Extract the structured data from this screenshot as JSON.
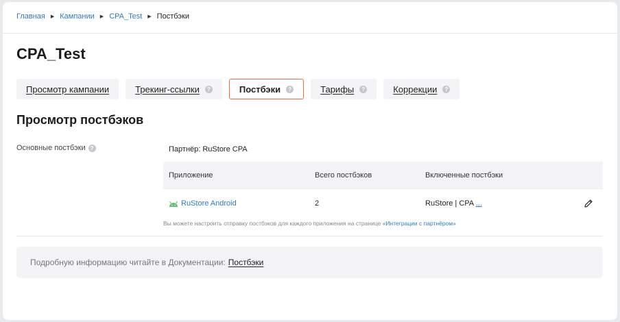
{
  "breadcrumb": {
    "items": [
      "Главная",
      "Кампании",
      "CPA_Test"
    ],
    "current": "Постбэки"
  },
  "page": {
    "title": "CPA_Test",
    "section_title": "Просмотр постбэков"
  },
  "tabs": [
    {
      "label": "Просмотр кампании",
      "has_help": false,
      "active": false
    },
    {
      "label": "Трекинг-ссылки",
      "has_help": true,
      "active": false
    },
    {
      "label": "Постбэки",
      "has_help": true,
      "active": true
    },
    {
      "label": "Тарифы",
      "has_help": true,
      "active": false
    },
    {
      "label": "Коррекции",
      "has_help": true,
      "active": false
    }
  ],
  "postbacks": {
    "side_label": "Основные постбэки",
    "partner_label": "Партнёр: RuStore CPA",
    "columns": [
      "Приложение",
      "Всего постбэков",
      "Включенные постбэки"
    ],
    "rows": [
      {
        "app": "RuStore Android",
        "app_icon": "android-icon",
        "total": "2",
        "enabled": "RuStore | CPA",
        "enabled_more": "..."
      }
    ],
    "hint_text": "Вы можете настроить отправку постбэков для каждого приложения на странице",
    "hint_link": "«Интеграции с партнёром»"
  },
  "docs": {
    "text": "Подробную информацию читайте в Документации:",
    "link": "Постбэки"
  },
  "help_icon_glyph": "?",
  "colors": {
    "accent": "#ee6a3c",
    "link": "#2f7bc4",
    "android": "#5fbf6f"
  }
}
